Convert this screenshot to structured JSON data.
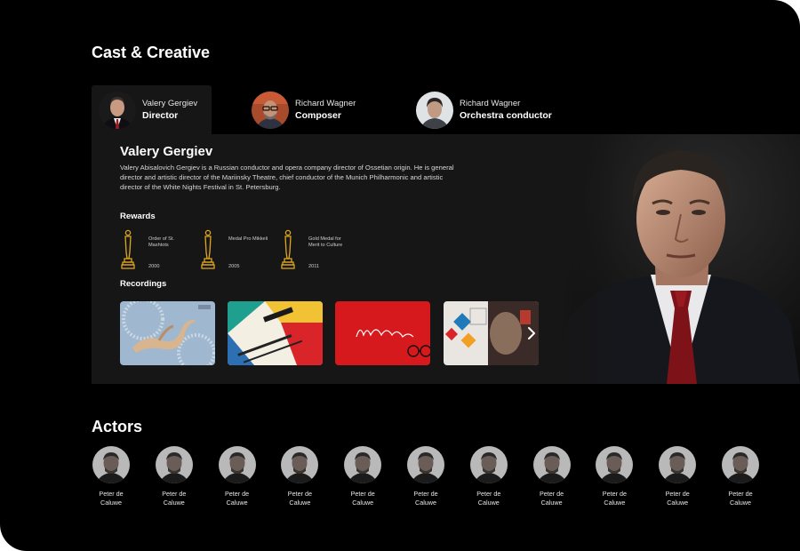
{
  "cast": {
    "title": "Cast & Creative",
    "tabs": [
      {
        "name": "Valery Gergiev",
        "role": "Director",
        "active": true
      },
      {
        "name": "Richard Wagner",
        "role": "Composer",
        "active": false
      },
      {
        "name": "Richard Wagner",
        "role": "Orchestra conductor",
        "active": false
      }
    ]
  },
  "bio": {
    "name": "Valery Gergiev",
    "text": "Valery Abisalovich Gergiev is a Russian conductor and opera company director of Ossetian origin. He is general director and artistic director of the Mariinsky Theatre, chief conductor of the Munich Philharmonic and artistic director of the White Nights Festival in St. Petersburg."
  },
  "rewards": {
    "title": "Rewards",
    "items": [
      {
        "name": "Order of St. Mashtots",
        "year": "2000"
      },
      {
        "name": "Medal Pro Mikkeli",
        "year": "2005"
      },
      {
        "name": "Gold Medal for Merit to Culture",
        "year": "2011"
      }
    ]
  },
  "recordings": {
    "title": "Recordings",
    "item_names": [
      "recording-1",
      "recording-2",
      "recording-3",
      "recording-4"
    ],
    "icon": "chevron-right-icon"
  },
  "actors": {
    "title": "Actors",
    "items": [
      "Peter de Caluwe",
      "Peter de Caluwe",
      "Peter de Caluwe",
      "Peter de Caluwe",
      "Peter de Caluwe",
      "Peter de Caluwe",
      "Peter de Caluwe",
      "Peter de Caluwe",
      "Peter de Caluwe",
      "Peter de Caluwe",
      "Peter de Caluwe"
    ]
  },
  "colors": {
    "background": "#000000",
    "panel": "#161616",
    "award_gold": "#e0a81c",
    "recording_red": "#d6191c"
  }
}
